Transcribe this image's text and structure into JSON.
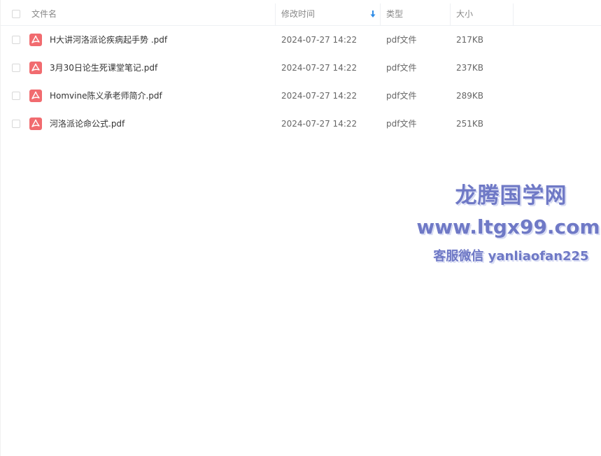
{
  "table": {
    "columns": {
      "name": "文件名",
      "modified": "修改时间",
      "type": "类型",
      "size": "大小"
    },
    "sort_icon": "sort-down-arrow-icon",
    "rows": [
      {
        "name": "H大讲河洛派论疾病起手势 .pdf",
        "modified": "2024-07-27 14:22",
        "type": "pdf文件",
        "size": "217KB"
      },
      {
        "name": "3月30日论生死课堂笔记.pdf",
        "modified": "2024-07-27 14:22",
        "type": "pdf文件",
        "size": "237KB"
      },
      {
        "name": "Homvine陈义承老师简介.pdf",
        "modified": "2024-07-27 14:22",
        "type": "pdf文件",
        "size": "289KB"
      },
      {
        "name": "河洛派论命公式.pdf",
        "modified": "2024-07-27 14:22",
        "type": "pdf文件",
        "size": "251KB"
      }
    ]
  },
  "watermark": {
    "title": "龙腾国学网",
    "url": "www.ltgx99.com",
    "contact": "客服微信 yanliaofan225"
  },
  "colors": {
    "pdf_icon": "#f16b6f",
    "sort_icon": "#2f8ce6",
    "watermark": "#6f79c6"
  }
}
